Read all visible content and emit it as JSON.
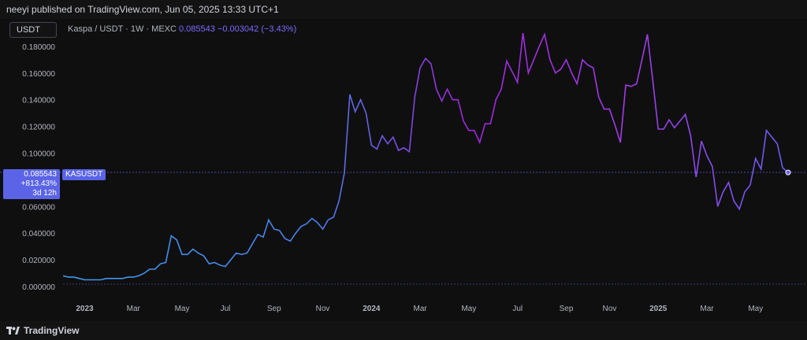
{
  "header": {
    "published_by": "neeyi published on TradingView.com, Jun 05, 2025 13:33 UTC+1"
  },
  "toolbar": {
    "currency": "USDT"
  },
  "legend": {
    "pair": "Kaspa / USDT · 1W · MEXC",
    "price": "0.085543",
    "change": "−0.003042 (−3.43%)"
  },
  "price_tag": {
    "price": "0.085543",
    "change_pct": "+813.43%",
    "countdown": "3d 12h",
    "symbol": "KASUSDT"
  },
  "footer": {
    "brand": "TradingView"
  },
  "colors": {
    "line_start": "#3d9be9",
    "line_mid": "#9c27d9",
    "line_end": "#6a5cf0",
    "tag": "#5b64e6",
    "grid": "#1e1e1e",
    "text": "#b2b5be"
  },
  "chart_data": {
    "type": "line",
    "title": "Kaspa / USDT · 1W · MEXC",
    "series": [
      {
        "name": "KASUSDT",
        "values": [
          0.008,
          0.007,
          0.007,
          0.006,
          0.005,
          0.005,
          0.005,
          0.005,
          0.006,
          0.006,
          0.006,
          0.006,
          0.007,
          0.007,
          0.008,
          0.01,
          0.013,
          0.013,
          0.017,
          0.018,
          0.038,
          0.035,
          0.024,
          0.024,
          0.028,
          0.025,
          0.023,
          0.017,
          0.018,
          0.016,
          0.015,
          0.02,
          0.025,
          0.024,
          0.025,
          0.032,
          0.039,
          0.037,
          0.05,
          0.043,
          0.042,
          0.036,
          0.034,
          0.04,
          0.045,
          0.047,
          0.051,
          0.048,
          0.043,
          0.05,
          0.052,
          0.064,
          0.085,
          0.144,
          0.131,
          0.14,
          0.13,
          0.106,
          0.103,
          0.113,
          0.107,
          0.112,
          0.102,
          0.104,
          0.101,
          0.142,
          0.164,
          0.171,
          0.167,
          0.148,
          0.139,
          0.148,
          0.14,
          0.14,
          0.124,
          0.117,
          0.117,
          0.108,
          0.122,
          0.122,
          0.14,
          0.148,
          0.169,
          0.161,
          0.153,
          0.19,
          0.16,
          0.17,
          0.18,
          0.189,
          0.17,
          0.16,
          0.163,
          0.17,
          0.16,
          0.152,
          0.17,
          0.166,
          0.164,
          0.142,
          0.133,
          0.133,
          0.121,
          0.108,
          0.151,
          0.15,
          0.152,
          0.17,
          0.189,
          0.154,
          0.118,
          0.118,
          0.125,
          0.119,
          0.124,
          0.129,
          0.113,
          0.082,
          0.109,
          0.098,
          0.09,
          0.06,
          0.071,
          0.078,
          0.064,
          0.058,
          0.071,
          0.076,
          0.096,
          0.088,
          0.117,
          0.112,
          0.107,
          0.089,
          0.0855
        ]
      }
    ],
    "x_tick_labels": [
      "2023",
      "Mar",
      "May",
      "Jul",
      "Sep",
      "Nov",
      "2024",
      "Mar",
      "May",
      "Jul",
      "Sep",
      "Nov",
      "2025",
      "Mar",
      "May"
    ],
    "x_tick_week_index": [
      4,
      13,
      22,
      30,
      39,
      48,
      57,
      66,
      75,
      84,
      93,
      101,
      110,
      119,
      128
    ],
    "y_ticks": [
      0.0,
      0.02,
      0.04,
      0.06,
      0.08,
      0.1,
      0.12,
      0.14,
      0.16,
      0.18
    ],
    "y_tick_labels": [
      "0.000000",
      "0.020000",
      "0.040000",
      "0.060000",
      "0.080000",
      "0.100000",
      "0.120000",
      "0.140000",
      "0.160000",
      "0.180000"
    ],
    "ylim": [
      0.0,
      0.19
    ],
    "last_value": 0.085543,
    "grid": false,
    "legend": "top-left"
  }
}
